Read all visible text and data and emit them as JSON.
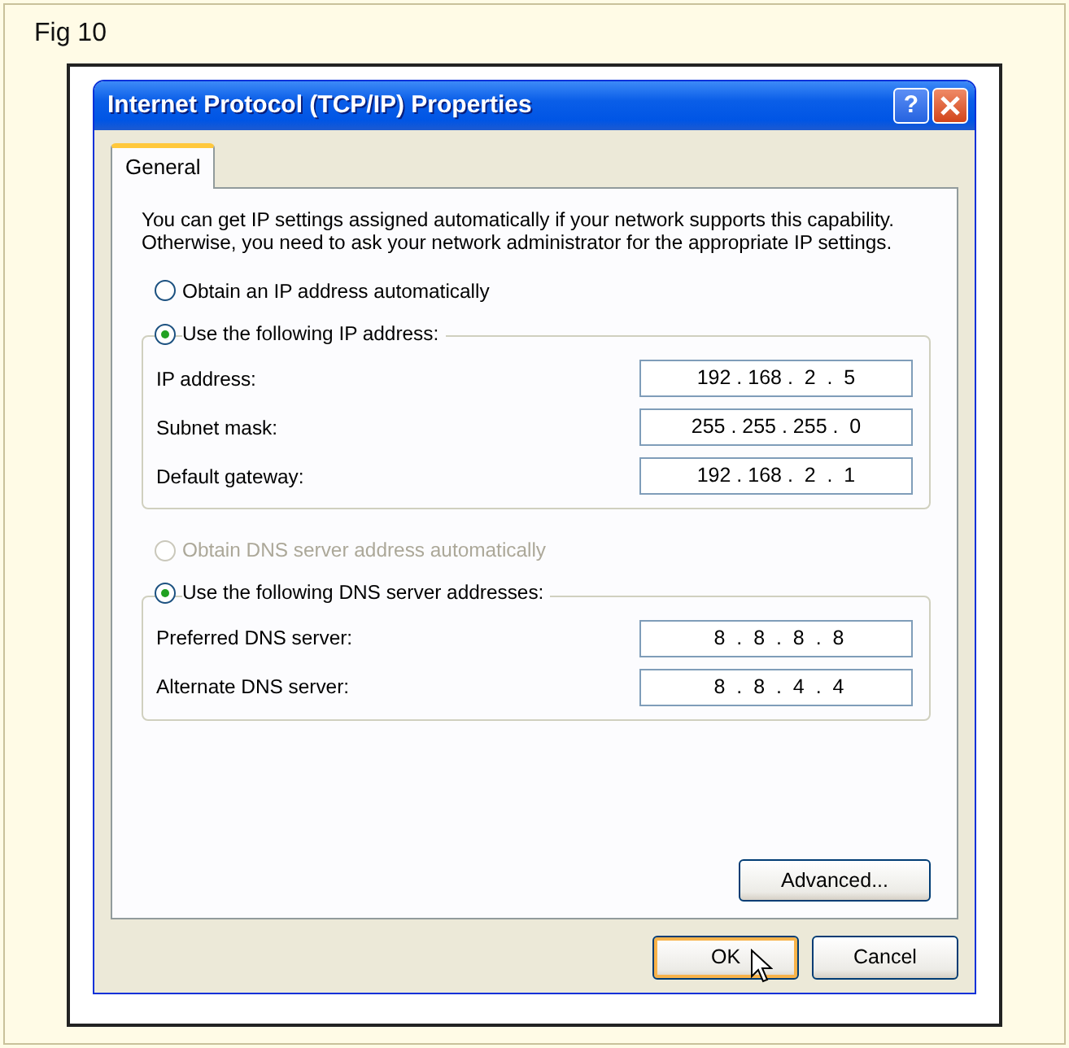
{
  "figure": {
    "caption": "Fig 10"
  },
  "window": {
    "title": "Internet Protocol (TCP/IP) Properties",
    "help_button": "?"
  },
  "tabs": [
    {
      "label": "General",
      "selected": true
    }
  ],
  "description": "You can get IP settings assigned automatically if your network supports this capability. Otherwise, you need to ask your network administrator for the appropriate IP settings.",
  "ip_options": [
    {
      "label": "Obtain an IP address automatically",
      "selected": false,
      "disabled": false
    },
    {
      "label": "Use the following IP address:",
      "selected": true,
      "disabled": false,
      "fields": [
        {
          "label": "IP address:",
          "value": "192 . 168 .  2  .  5"
        },
        {
          "label": "Subnet mask:",
          "value": "255 . 255 . 255 .  0"
        },
        {
          "label": "Default gateway:",
          "value": "192 . 168 .  2  .  1"
        }
      ]
    }
  ],
  "dns_options": [
    {
      "label": "Obtain DNS server address automatically",
      "selected": false,
      "disabled": true
    },
    {
      "label": "Use the following DNS server addresses:",
      "selected": true,
      "disabled": false,
      "fields": [
        {
          "label": "Preferred DNS server:",
          "value": " 8  .  8  .  8  .  8"
        },
        {
          "label": "Alternate DNS server:",
          "value": " 8  .  8  .  4  .  4"
        }
      ]
    }
  ],
  "advanced_button": "Advanced...",
  "footer_buttons": [
    {
      "label": "OK",
      "default": true,
      "hovered": true
    },
    {
      "label": "Cancel",
      "default": false,
      "hovered": false
    }
  ]
}
